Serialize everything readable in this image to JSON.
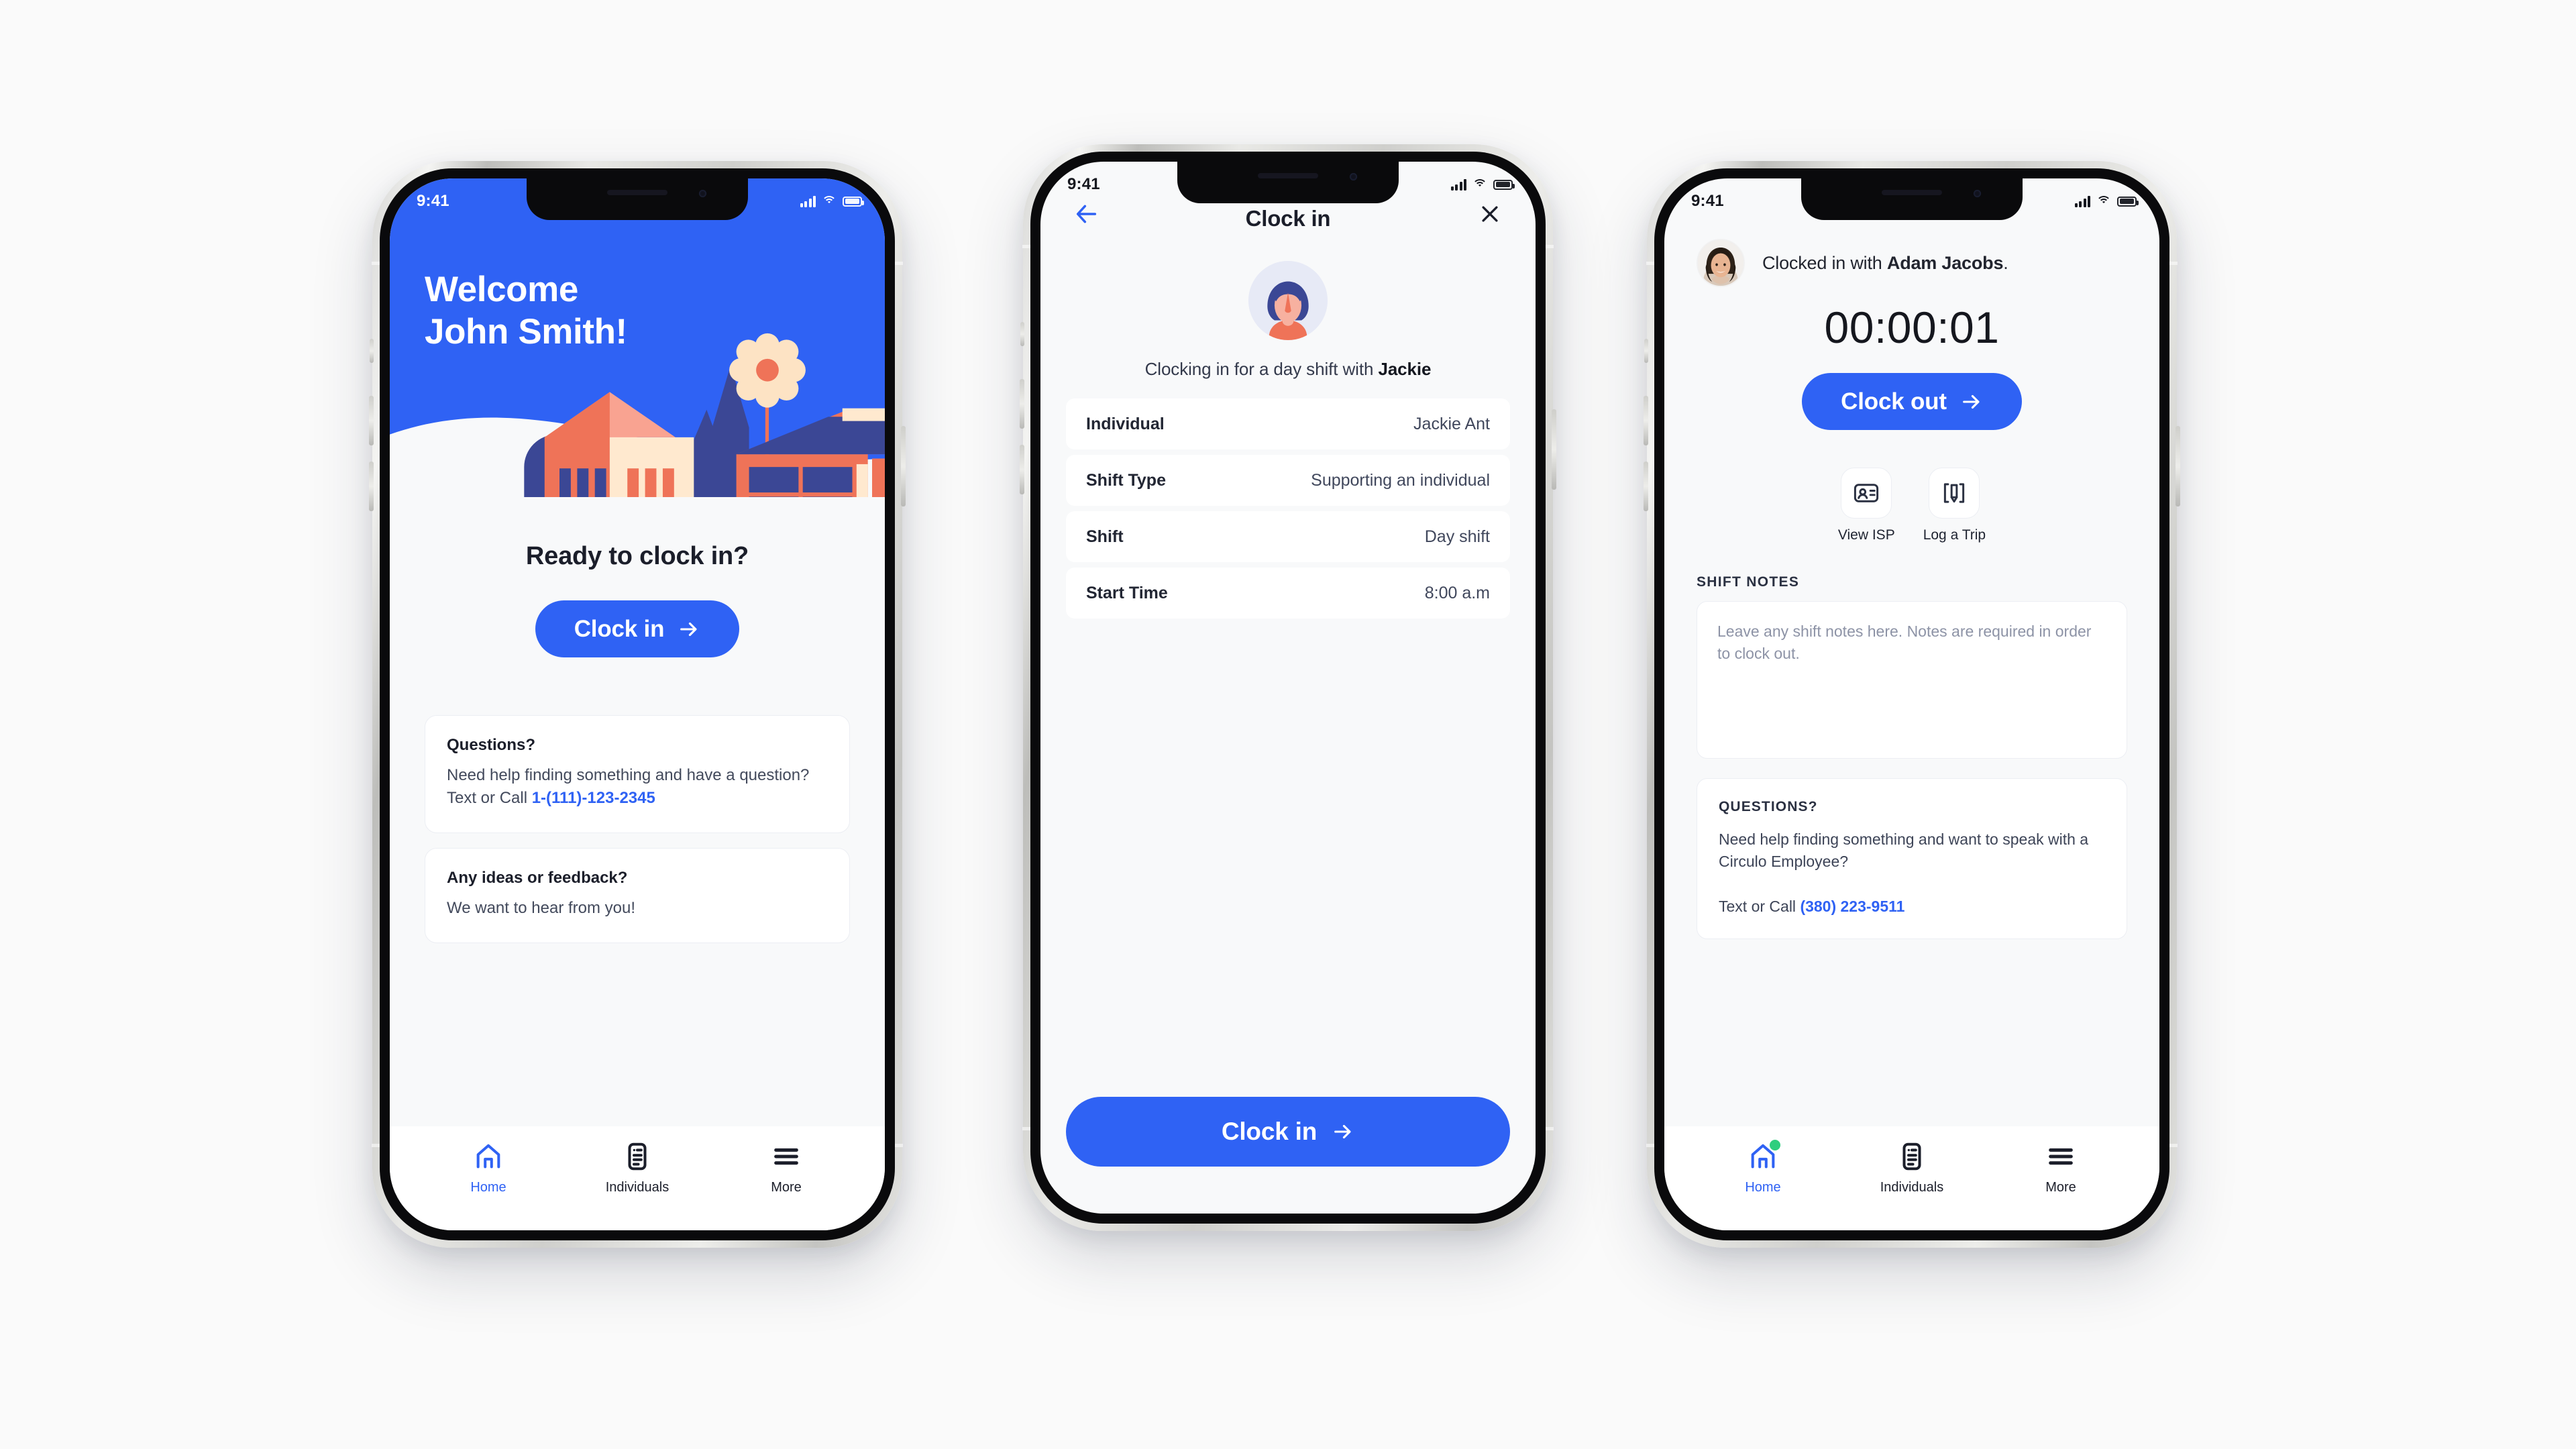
{
  "meta": {
    "accent_blue": "#2f62f4",
    "badge_green": "#2fce7e",
    "page_bg": "#fafafa"
  },
  "status_bar": {
    "time": "9:41"
  },
  "phone1": {
    "hero": {
      "line1": "Welcome",
      "line2": "John Smith!"
    },
    "ready_heading": "Ready to clock in?",
    "clock_in_button": "Clock in",
    "cards": [
      {
        "title": "Questions?",
        "text": "Need help finding something and have a question? Text or Call ",
        "link": "1-(111)-123-2345"
      },
      {
        "title": "Any ideas or feedback?",
        "text": "We want to hear from you!",
        "link": ""
      }
    ],
    "tabs": [
      {
        "label": "Home",
        "icon": "home-icon",
        "active": true,
        "badge": false
      },
      {
        "label": "Individuals",
        "icon": "document-list-icon",
        "active": false,
        "badge": false
      },
      {
        "label": "More",
        "icon": "hamburger-menu-icon",
        "active": false,
        "badge": false
      }
    ]
  },
  "phone2": {
    "nav": {
      "title": "Clock in",
      "back_icon": "arrow-left-icon",
      "close_icon": "close-icon"
    },
    "subtitle_prefix": "Clocking in for a day shift with ",
    "subtitle_name": "Jackie",
    "detail_rows": [
      {
        "key": "Individual",
        "value": "Jackie Ant"
      },
      {
        "key": "Shift Type",
        "value": "Supporting an individual"
      },
      {
        "key": "Shift",
        "value": "Day shift"
      },
      {
        "key": "Start Time",
        "value": "8:00 a.m"
      }
    ],
    "submit_button": "Clock in"
  },
  "phone3": {
    "clocked_prefix": "Clocked in with ",
    "clocked_name": "Adam Jacobs",
    "clocked_suffix": ".",
    "timer": "00:00:01",
    "clock_out_button": "Clock out",
    "quick_actions": [
      {
        "label": "View ISP",
        "icon": "id-card-icon"
      },
      {
        "label": "Log a Trip",
        "icon": "pen-brackets-icon"
      }
    ],
    "shift_notes_heading": "SHIFT NOTES",
    "shift_notes_placeholder": "Leave any shift notes here. Notes are required in order to clock out.",
    "shift_notes_value": "",
    "questions_card": {
      "title": "QUESTIONS?",
      "body": "Need help finding something and want to speak with a Circulo Employee?",
      "call_prefix": "Text or Call ",
      "phone": "(380) 223-9511"
    },
    "tabs": [
      {
        "label": "Home",
        "icon": "home-icon",
        "active": true,
        "badge": true
      },
      {
        "label": "Individuals",
        "icon": "document-list-icon",
        "active": false,
        "badge": false
      },
      {
        "label": "More",
        "icon": "hamburger-menu-icon",
        "active": false,
        "badge": false
      }
    ]
  }
}
